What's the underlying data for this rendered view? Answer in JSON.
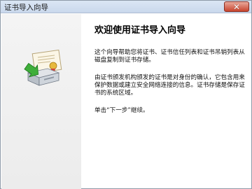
{
  "window": {
    "title": "证书导入向导",
    "close_symbol": "✕"
  },
  "icons": {
    "close": "close-icon",
    "wizard_art": "certificate-import-icon"
  },
  "content": {
    "heading": "欢迎使用证书导入向导",
    "paragraph1": "这个向导帮助您将证书、证书信任列表和证书吊销列表从磁盘复制到证书存储。",
    "paragraph2": "由证书颁发机构颁发的证书是对身份的确认，它包含用来保护数据或建立安全网络连接的信息。证书存储是保存证书的系统区域。",
    "paragraph3": "单击“下一步”继续。"
  }
}
